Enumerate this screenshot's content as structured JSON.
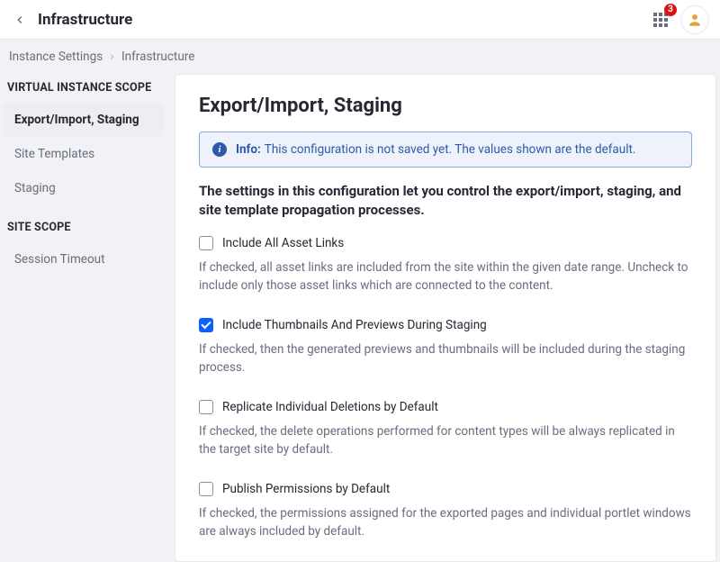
{
  "header": {
    "title": "Infrastructure",
    "badge_count": "3"
  },
  "breadcrumb": {
    "parent": "Instance Settings",
    "current": "Infrastructure"
  },
  "sidebar": {
    "groups": [
      {
        "title": "VIRTUAL INSTANCE SCOPE",
        "items": [
          {
            "label": "Export/Import, Staging"
          },
          {
            "label": "Site Templates"
          },
          {
            "label": "Staging"
          }
        ]
      },
      {
        "title": "SITE SCOPE",
        "items": [
          {
            "label": "Session Timeout"
          }
        ]
      }
    ]
  },
  "main": {
    "title": "Export/Import, Staging",
    "alert_label": "Info:",
    "alert_text": "This configuration is not saved yet. The values shown are the default.",
    "intro": "The settings in this configuration let you control the export/import, staging, and site template propagation processes.",
    "options": [
      {
        "label": "Include All Asset Links",
        "checked": false,
        "desc": "If checked, all asset links are included from the site within the given date range. Uncheck to include only those asset links which are connected to the content."
      },
      {
        "label": "Include Thumbnails And Previews During Staging",
        "checked": true,
        "desc": "If checked, then the generated previews and thumbnails will be included during the staging process."
      },
      {
        "label": "Replicate Individual Deletions by Default",
        "checked": false,
        "desc": "If checked, the delete operations performed for content types will be always replicated in the target site by default."
      },
      {
        "label": "Publish Permissions by Default",
        "checked": false,
        "desc": "If checked, the permissions assigned for the exported pages and individual portlet windows are always included by default."
      }
    ]
  }
}
